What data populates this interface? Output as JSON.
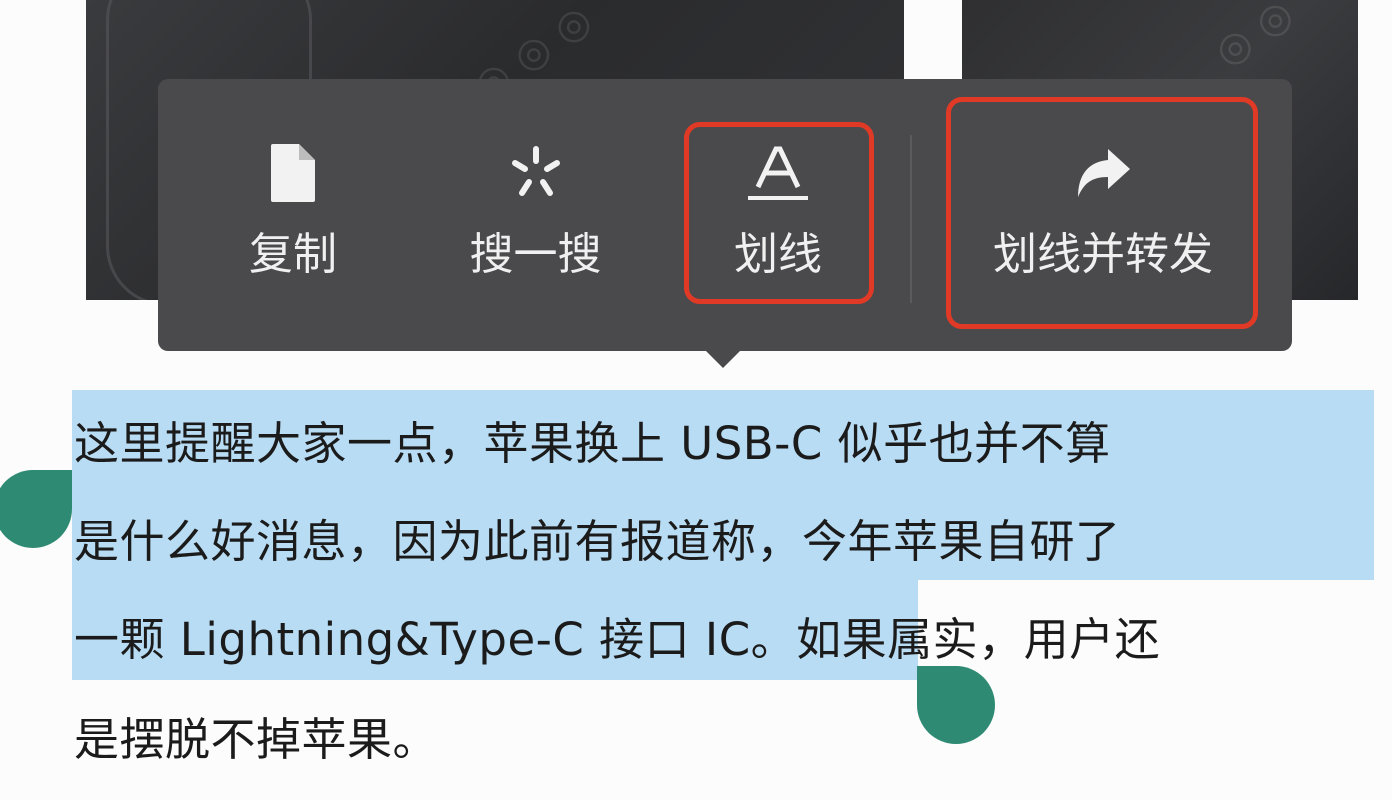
{
  "menu": {
    "items": [
      {
        "id": "copy",
        "label": "复制",
        "icon": "document-icon"
      },
      {
        "id": "search",
        "label": "搜一搜",
        "icon": "search-spark-icon"
      },
      {
        "id": "underline",
        "label": "划线",
        "icon": "underline-icon"
      },
      {
        "id": "underline_share",
        "label": "划线并转发",
        "icon": "share-arrow-icon"
      }
    ],
    "highlight_color": "#e03a26",
    "background_color": "#4a4a4c"
  },
  "article": {
    "lines": [
      "这里提醒大家一点，苹果换上 USB-C 似乎也并不算",
      "是什么好消息，因为此前有报道称，今年苹果自研了",
      "一颗 Lightning&Type-C 接口 IC。",
      "是摆脱不掉苹果。"
    ],
    "line3_unselected": "如果属实，用户还",
    "selection_color": "#b8dcf3",
    "handle_color": "#2e8a72"
  }
}
